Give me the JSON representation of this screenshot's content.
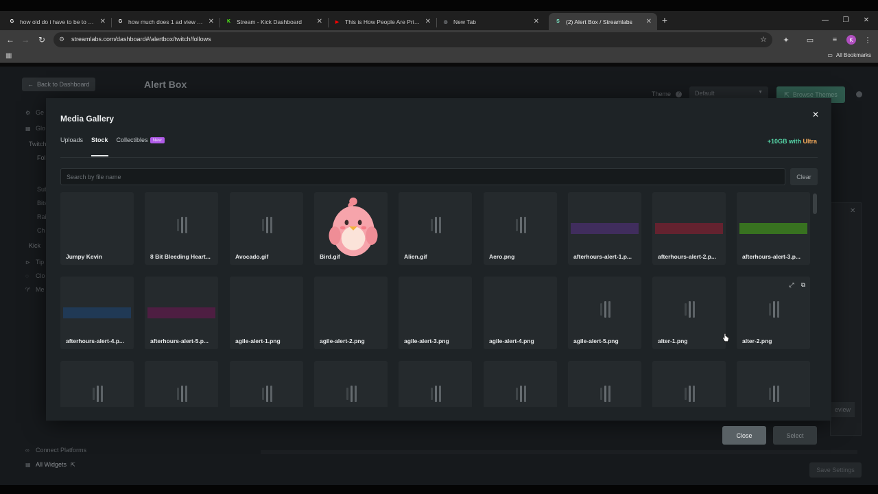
{
  "browser": {
    "tabs": [
      {
        "title": "how old do i have to be to be a",
        "favicon_color": "#ffffff",
        "favicon_glyph": "G"
      },
      {
        "title": "how much does 1 ad view prov",
        "favicon_color": "#ffffff",
        "favicon_glyph": "G"
      },
      {
        "title": "Stream - Kick Dashboard",
        "favicon_color": "#53fc18",
        "favicon_glyph": "K"
      },
      {
        "title": "This is How People Are Printing",
        "favicon_color": "#ff0000",
        "favicon_glyph": "▶"
      },
      {
        "title": "New Tab",
        "favicon_color": "#9aa0a6",
        "favicon_glyph": "◍"
      },
      {
        "title": "(2) Alert Box / Streamlabs",
        "favicon_color": "#80f5d2",
        "favicon_glyph": "S"
      }
    ],
    "url": "streamlabs.com/dashboard#/alertbox/twitch/follows",
    "profile_initial": "K",
    "bookmarks_label": "All Bookmarks"
  },
  "page": {
    "back_label": "Back to Dashboard",
    "title": "Alert Box",
    "theme_label": "Theme",
    "theme_value": "Default",
    "browse_themes_label": "Browse Themes",
    "sidebar": [
      "Ge",
      "Glo",
      "Twitch",
      "Fol",
      "Sub",
      "Bits",
      "Rai",
      "Ch",
      "Kick",
      "Tip",
      "Clo",
      "Me"
    ],
    "connect_platforms": "Connect Platforms",
    "all_widgets": "All Widgets",
    "review_label": "eview",
    "save_settings": "Save Settings"
  },
  "modal": {
    "title": "Media Gallery",
    "tabs": [
      {
        "label": "Uploads",
        "active": false
      },
      {
        "label": "Stock",
        "active": true
      },
      {
        "label": "Collectibles",
        "active": false,
        "badge": "New"
      }
    ],
    "ultra_plus": "+10GB with ",
    "ultra_word": "Ultra",
    "search_placeholder": "Search by file name",
    "clear_label": "Clear",
    "items": [
      {
        "name": "Jumpy Kevin",
        "thumb": "blank"
      },
      {
        "name": "8 Bit Bleeding Heart...",
        "thumb": "bars"
      },
      {
        "name": "Avocado.gif",
        "thumb": "bars"
      },
      {
        "name": "Bird.gif",
        "thumb": "bird"
      },
      {
        "name": "Alien.gif",
        "thumb": "bars"
      },
      {
        "name": "Aero.png",
        "thumb": "bars"
      },
      {
        "name": "afterhours-alert-1.p...",
        "thumb": "strip",
        "color": "#4a2f6e"
      },
      {
        "name": "afterhours-alert-2.p...",
        "thumb": "strip",
        "color": "#7a2030"
      },
      {
        "name": "afterhours-alert-3.p...",
        "thumb": "strip",
        "color": "#3f8a1c"
      },
      {
        "name": "afterhours-alert-4.p...",
        "thumb": "strip",
        "color": "#1f3e63"
      },
      {
        "name": "afterhours-alert-5.p...",
        "thumb": "strip",
        "color": "#5c1a4a"
      },
      {
        "name": "agile-alert-1.png",
        "thumb": "blank"
      },
      {
        "name": "agile-alert-2.png",
        "thumb": "blank"
      },
      {
        "name": "agile-alert-3.png",
        "thumb": "blank"
      },
      {
        "name": "agile-alert-4.png",
        "thumb": "blank"
      },
      {
        "name": "agile-alert-5.png",
        "thumb": "bars"
      },
      {
        "name": "alter-1.png",
        "thumb": "bars"
      },
      {
        "name": "alter-2.png",
        "thumb": "bars",
        "hover": true
      },
      {
        "name": "",
        "thumb": "bars"
      },
      {
        "name": "",
        "thumb": "bars"
      },
      {
        "name": "",
        "thumb": "bars"
      },
      {
        "name": "",
        "thumb": "bars"
      },
      {
        "name": "",
        "thumb": "bars"
      },
      {
        "name": "",
        "thumb": "bars"
      },
      {
        "name": "",
        "thumb": "bars"
      },
      {
        "name": "",
        "thumb": "bars"
      },
      {
        "name": "",
        "thumb": "bars"
      }
    ],
    "close_label": "Close",
    "select_label": "Select"
  }
}
